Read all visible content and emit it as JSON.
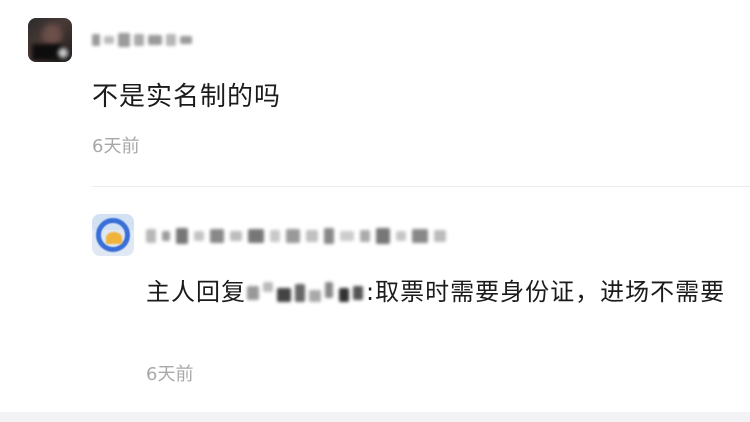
{
  "comment": {
    "text": "不是实名制的吗",
    "time": "6天前"
  },
  "reply": {
    "prefix": "主人回复",
    "text": ":取票时需要身份证，进场不需要",
    "time": "6天前"
  },
  "colors": {
    "text": "#1b1b1b",
    "meta": "#a8a8a8",
    "divider": "#ececec"
  },
  "icons": {
    "comment_avatar": "user-avatar-icon",
    "reply_avatar": "owner-avatar-icon"
  }
}
